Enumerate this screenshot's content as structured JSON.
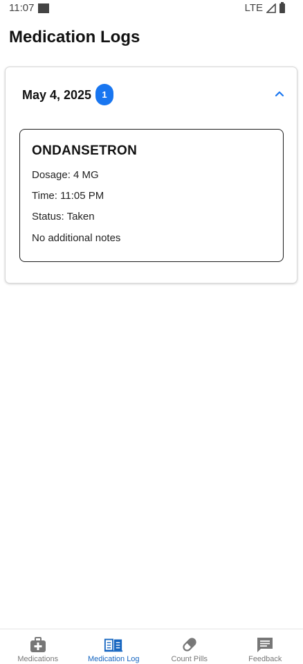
{
  "status_bar": {
    "time": "11:07",
    "network": "LTE"
  },
  "header": {
    "title": "Medication Logs"
  },
  "log_groups": [
    {
      "date": "May 4, 2025",
      "count": "1",
      "expanded": true,
      "entries": [
        {
          "name": "ONDANSETRON",
          "dosage": "Dosage: 4 MG",
          "time": "Time: 11:05 PM",
          "status": "Status: Taken",
          "notes": "No additional notes"
        }
      ]
    }
  ],
  "bottom_nav": {
    "items": [
      {
        "label": "Medications",
        "icon": "medical-bag-icon",
        "active": false
      },
      {
        "label": "Medication Log",
        "icon": "book-open-icon",
        "active": true
      },
      {
        "label": "Count Pills",
        "icon": "pill-icon",
        "active": false
      },
      {
        "label": "Feedback",
        "icon": "feedback-icon",
        "active": false
      }
    ]
  },
  "colors": {
    "accent": "#1976f0",
    "active_nav": "#1565c0",
    "inactive_nav": "#777777"
  }
}
